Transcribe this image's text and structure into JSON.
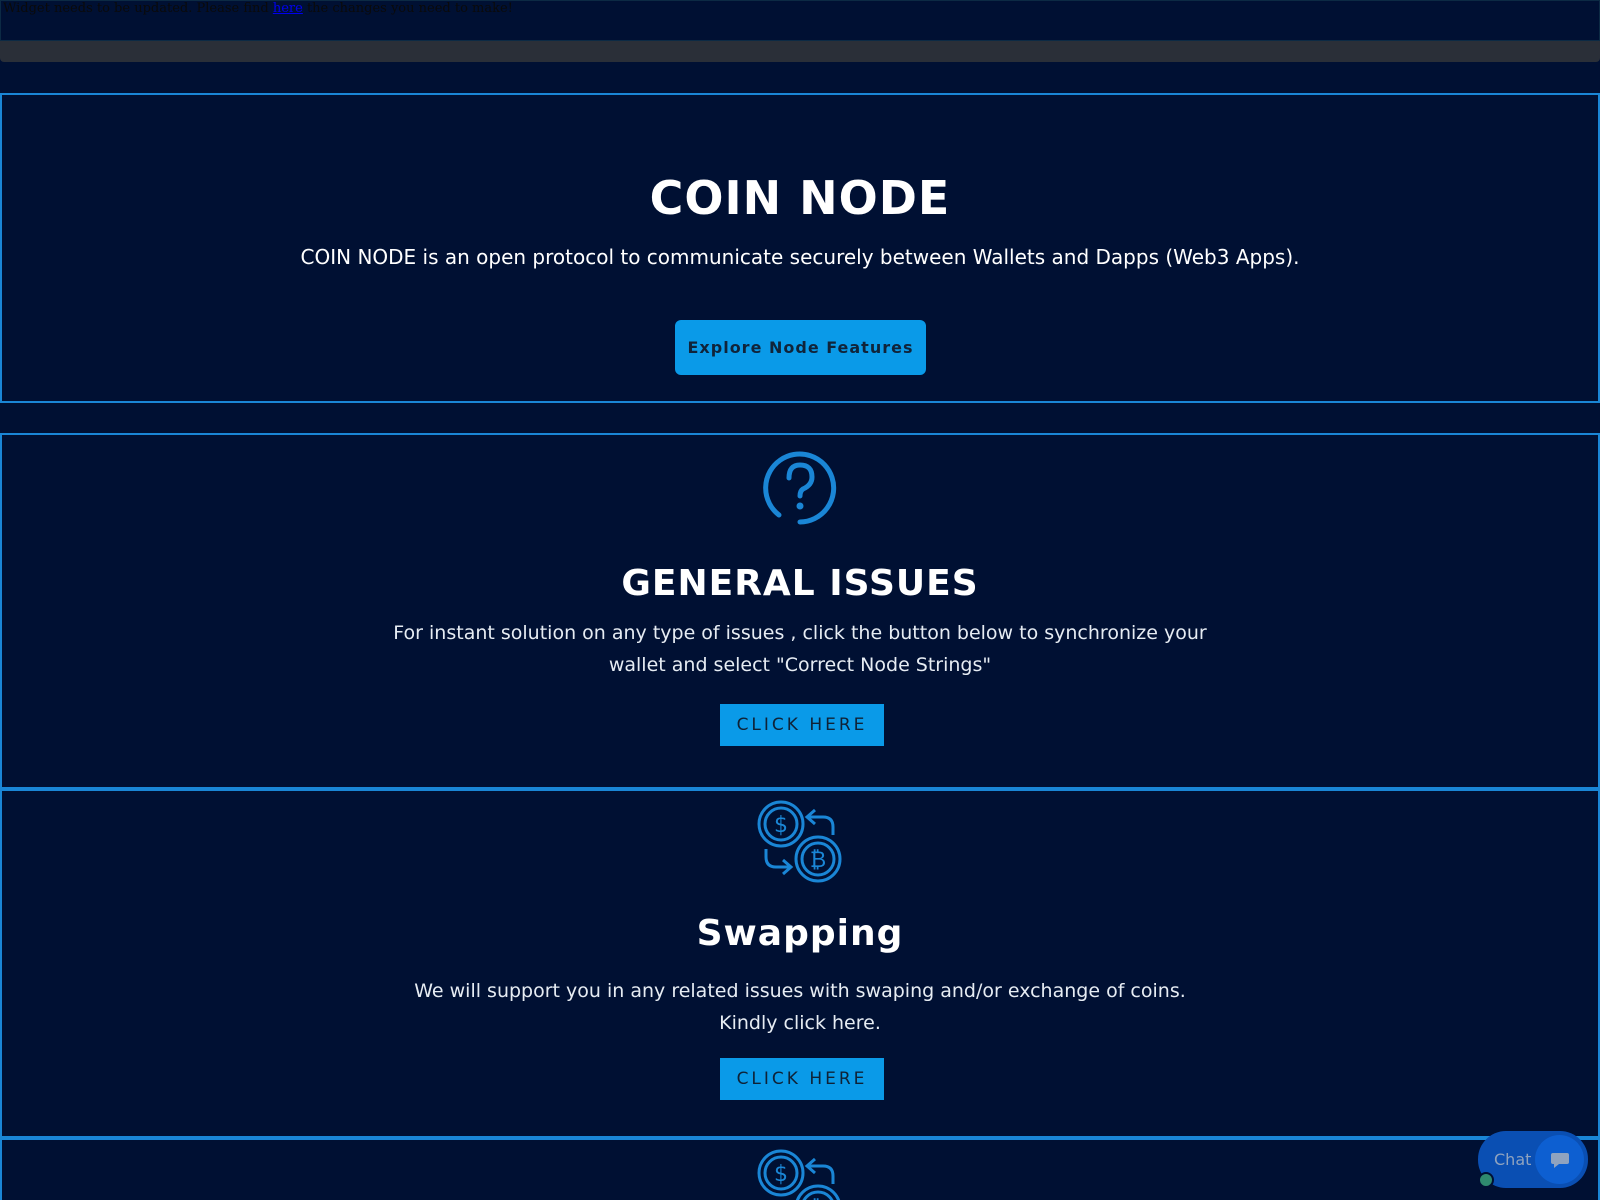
{
  "notice": {
    "prefix": "Widget needs to be updated. Please find ",
    "link": "here",
    "suffix": " the changes you need to make!"
  },
  "hero": {
    "title": "COIN NODE",
    "subtitle": "COIN NODE is an open protocol to communicate securely between Wallets and Dapps (Web3 Apps).",
    "button": "Explore Node Features"
  },
  "sections": [
    {
      "icon": "question-circle-icon",
      "title": "GENERAL ISSUES",
      "text_line1": "For instant solution on any type of issues , click the button below to synchronize your",
      "text_line2": "wallet and select \"Correct Node Strings\"",
      "button": "CLICK HERE"
    },
    {
      "icon": "coin-swap-icon",
      "title": "Swapping",
      "text_line1": "We will support you in any related issues with swaping and/or exchange of coins.",
      "text_line2": "Kindly click here.",
      "button": "CLICK HERE"
    },
    {
      "icon": "coin-swap-icon"
    }
  ],
  "chat": {
    "label": "Chat",
    "icon": "chat-bubble-icon"
  },
  "colors": {
    "background": "#001033",
    "accent": "#0a9ae8",
    "border": "#1a86d6"
  }
}
